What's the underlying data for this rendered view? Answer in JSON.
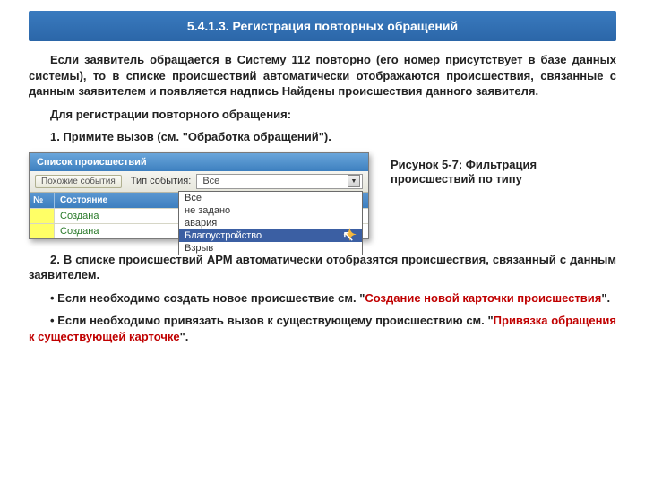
{
  "title": "5.4.1.3. Регистрация повторных обращений",
  "p1": "Если заявитель обращается в Систему 112 повторно (его номер присутствует в базе данных системы), то в списке происшествий автоматически отображаются происшествия, связанные с данным заявителем и появляется надпись Найдены происшествия данного заявителя.",
  "p2": "Для регистрации повторного обращения:",
  "p3": "1. Примите вызов (см. \"Обработка обращений\").",
  "caption": "Рисунок 5-7: Фильтрация происшествий по типу",
  "p4": "2. В списке происшествий АРМ автоматически отобразятся происшествия, связанный с данным заявителем.",
  "p5a": "• Если необходимо создать новое происшествие см. \"",
  "p5link": "Создание новой карточки происшествия",
  "p5b": "\".",
  "p6a": "• Если необходимо привязать вызов к существующему происшествию см. \"",
  "p6link": "Привязка обращения к существующей карточке",
  "p6b": "\".",
  "screenshot": {
    "header": "Список происшествий",
    "similar_btn": "Похожие события",
    "filter_label": "Тип события:",
    "selected": "Все",
    "options": [
      "Все",
      "не задано",
      "авария",
      "Благоустройство",
      "Взрыв"
    ],
    "col_num": "№",
    "col_state": "Состояние",
    "rows": [
      {
        "state": "Создана"
      },
      {
        "state": "Создана"
      }
    ]
  }
}
